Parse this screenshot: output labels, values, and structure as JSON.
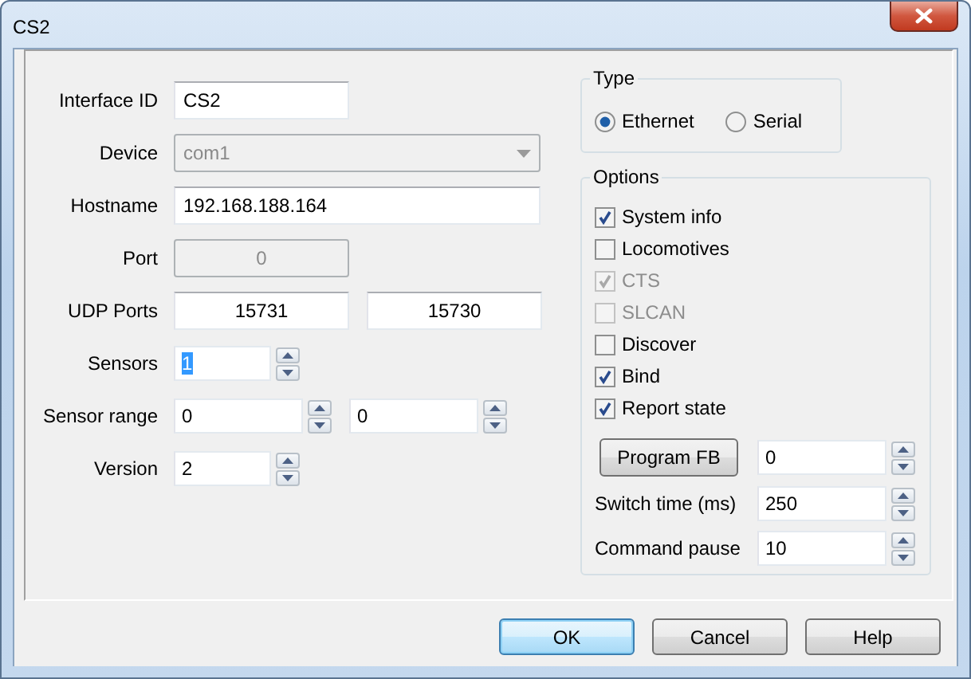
{
  "window": {
    "title": "CS2"
  },
  "fields": [
    {
      "label": "Interface ID",
      "inputs": [
        {
          "kind": "text",
          "value": "CS2",
          "disabled": false
        }
      ]
    },
    {
      "label": "Device",
      "inputs": [
        {
          "kind": "dropdown",
          "value": "com1",
          "disabled": true
        }
      ]
    },
    {
      "label": "Hostname",
      "inputs": [
        {
          "kind": "wide",
          "value": "192.168.188.164",
          "disabled": false
        }
      ]
    },
    {
      "label": "Port",
      "inputs": [
        {
          "kind": "number",
          "value": "0",
          "disabled": true
        }
      ]
    },
    {
      "label": "UDP Ports",
      "inputs": [
        {
          "kind": "number",
          "value": "15731",
          "disabled": false
        },
        {
          "kind": "number",
          "value": "15730",
          "disabled": false
        }
      ]
    },
    {
      "label": "Sensors",
      "inputs": [
        {
          "kind": "spin",
          "value": "1",
          "disabled": false,
          "highlighted": true
        }
      ]
    },
    {
      "label": "Sensor range",
      "inputs": [
        {
          "kind": "spin",
          "value": "0",
          "disabled": false,
          "highlighted": false
        },
        {
          "kind": "spin",
          "value": "0",
          "disabled": false,
          "highlighted": false
        }
      ]
    },
    {
      "label": "Version",
      "inputs": [
        {
          "kind": "spin",
          "value": "2",
          "disabled": false,
          "highlighted": false
        }
      ]
    }
  ],
  "type": {
    "title": "Type",
    "options": [
      {
        "label": "Ethernet",
        "selected": true
      },
      {
        "label": "Serial",
        "selected": false
      }
    ]
  },
  "options": {
    "title": "Options",
    "checkboxes": [
      {
        "label": "System info",
        "checked": true,
        "disabled": false
      },
      {
        "label": "Locomotives",
        "checked": false,
        "disabled": false
      },
      {
        "label": "CTS",
        "checked": true,
        "disabled": true
      },
      {
        "label": "SLCAN",
        "checked": false,
        "disabled": true
      },
      {
        "label": "Discover",
        "checked": false,
        "disabled": false
      },
      {
        "label": "Bind",
        "checked": true,
        "disabled": false
      },
      {
        "label": "Report state",
        "checked": true,
        "disabled": false
      }
    ],
    "rows": [
      {
        "kind": "button",
        "label": "Program FB",
        "value": "0"
      },
      {
        "kind": "label",
        "label": "Switch time (ms)",
        "value": "250"
      },
      {
        "kind": "label",
        "label": "Command pause",
        "value": "10"
      }
    ]
  },
  "buttons": [
    {
      "label": "OK",
      "default": true
    },
    {
      "label": "Cancel",
      "default": false
    },
    {
      "label": "Help",
      "default": false
    }
  ]
}
